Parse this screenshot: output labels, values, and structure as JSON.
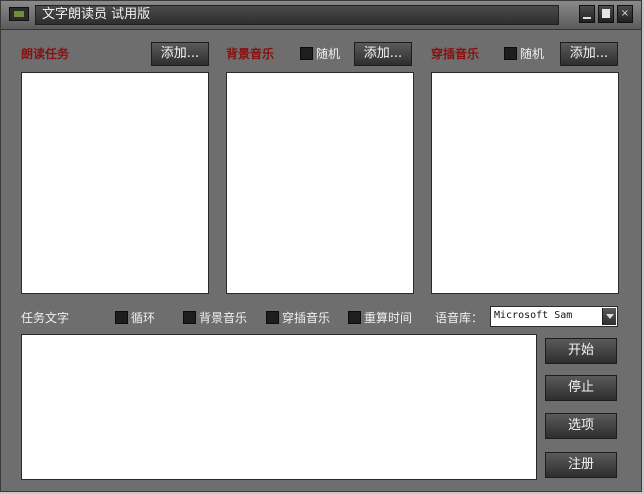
{
  "window": {
    "title": "文字朗读员  试用版"
  },
  "panels": {
    "read_task": {
      "label": "朗读任务",
      "add_label": "添加..."
    },
    "background_music": {
      "label": "背景音乐",
      "random_label": "随机",
      "add_label": "添加..."
    },
    "insert_music": {
      "label": "穿插音乐",
      "random_label": "随机",
      "add_label": "添加..."
    }
  },
  "task_text": {
    "label": "任务文字",
    "options": [
      "循环",
      "背景音乐",
      "穿插音乐",
      "重算时间"
    ]
  },
  "voice_library": {
    "label": "语音库：",
    "selected": "Microsoft Sam"
  },
  "actions": {
    "start": "开始",
    "stop": "停止",
    "options": "选项",
    "register": "注册"
  },
  "colors": {
    "window_bg": "#6e6e6e",
    "section_label": "#8a1010",
    "button_text": "#f4f4f4"
  }
}
